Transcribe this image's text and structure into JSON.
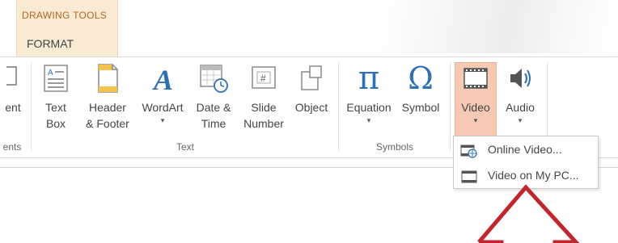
{
  "context_tab": {
    "group_label": "DRAWING TOOLS",
    "tab_label": "FORMAT"
  },
  "ribbon": {
    "cut_off_button": {
      "label_line1": "ent",
      "group_label": "ents"
    },
    "text_group": {
      "label": "Text",
      "buttons": [
        {
          "line1": "Text",
          "line2": "Box",
          "icon": "text-box-icon"
        },
        {
          "line1": "Header",
          "line2": "& Footer",
          "icon": "header-footer-icon"
        },
        {
          "line1": "WordArt",
          "line2": "▾",
          "icon": "wordart-icon"
        },
        {
          "line1": "Date &",
          "line2": "Time",
          "icon": "date-time-icon"
        },
        {
          "line1": "Slide",
          "line2": "Number",
          "icon": "slide-number-icon"
        },
        {
          "line1": "Object",
          "line2": "",
          "icon": "object-icon"
        }
      ]
    },
    "symbols_group": {
      "label": "Symbols",
      "equation": {
        "label": "Equation",
        "glyph": "π",
        "caret": "▾"
      },
      "symbol": {
        "label": "Symbol",
        "glyph": "Ω"
      }
    },
    "media_group": {
      "video": {
        "label": "Video",
        "caret": "▾"
      },
      "audio": {
        "label": "Audio",
        "caret": "▾"
      }
    }
  },
  "video_menu": {
    "items": [
      {
        "label": "Online Video...",
        "icon": "online-video-icon"
      },
      {
        "label": "Video on My PC...",
        "icon": "video-file-icon"
      }
    ]
  },
  "colors": {
    "context_tab_bg": "#f9ead3",
    "context_label": "#b5651d",
    "video_highlight": "#f5c9b3",
    "annotation_arrow": "#c0272d",
    "icon_blue": "#2f6fb3"
  }
}
